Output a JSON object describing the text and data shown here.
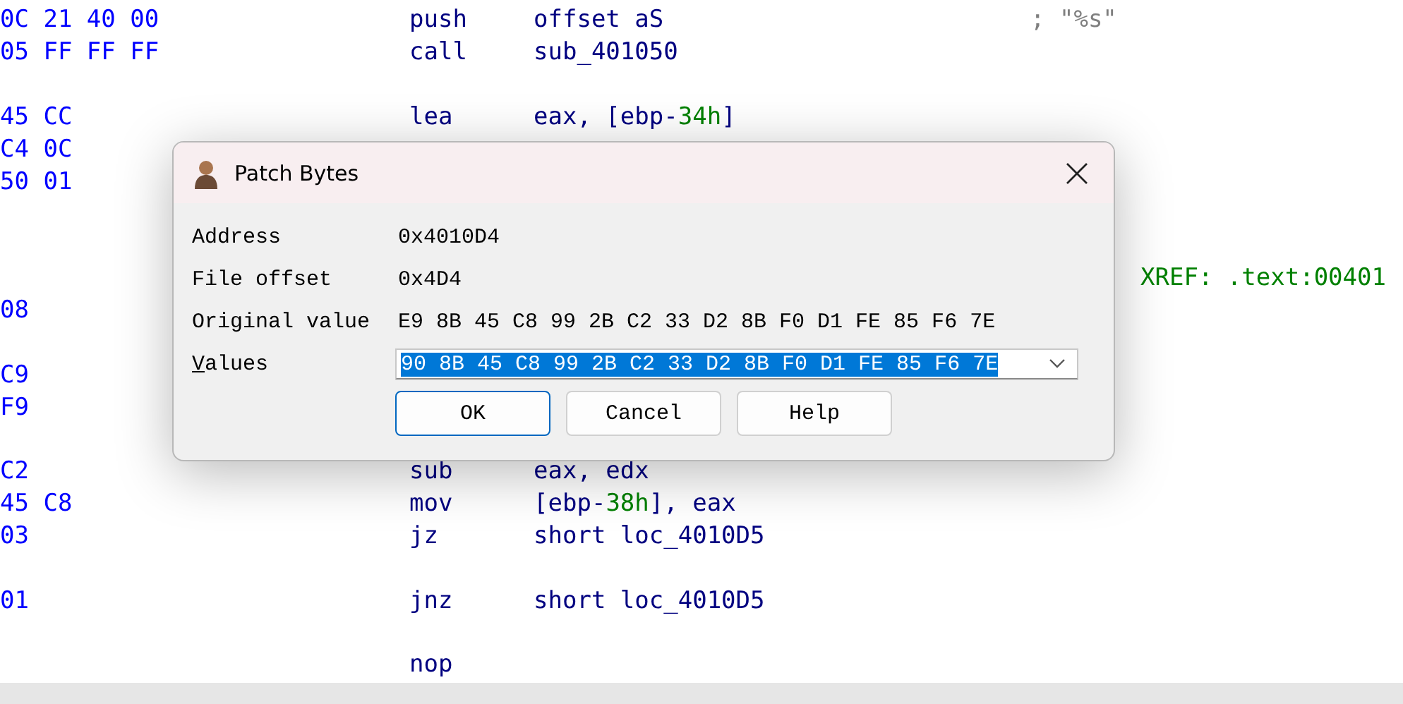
{
  "listing": [
    {
      "kind": "code",
      "bytes": "0C 21 40 00",
      "mnemonic": "push",
      "operand": [
        {
          "kind": "plain",
          "text": "offset aS"
        }
      ],
      "comment": "; \"%s\""
    },
    {
      "kind": "code",
      "bytes": "05 FF FF FF",
      "mnemonic": "call",
      "operand": [
        {
          "kind": "plain",
          "text": "sub_401050"
        }
      ]
    },
    {
      "kind": "blank"
    },
    {
      "kind": "code",
      "bytes": "45 CC",
      "mnemonic": "lea",
      "operand": [
        {
          "kind": "plain",
          "text": "eax, [ebp-"
        },
        {
          "kind": "number",
          "text": "34h"
        },
        {
          "kind": "plain",
          "text": "]"
        }
      ]
    },
    {
      "kind": "code",
      "bytes": "C4 0C"
    },
    {
      "kind": "code",
      "bytes": "50 01"
    },
    {
      "kind": "blank"
    },
    {
      "kind": "blank"
    },
    {
      "kind": "xref",
      "text": "XREF: .text:00401"
    },
    {
      "kind": "code",
      "bytes": "08"
    },
    {
      "kind": "blank"
    },
    {
      "kind": "code",
      "bytes": "C9"
    },
    {
      "kind": "code",
      "bytes": "F9"
    },
    {
      "kind": "blank"
    },
    {
      "kind": "code",
      "bytes": "C2",
      "mnemonic": "sub",
      "operand": [
        {
          "kind": "plain",
          "text": "eax, edx"
        }
      ]
    },
    {
      "kind": "code",
      "bytes": "45 C8",
      "mnemonic": "mov",
      "operand": [
        {
          "kind": "plain",
          "text": "[ebp-"
        },
        {
          "kind": "number",
          "text": "38h"
        },
        {
          "kind": "plain",
          "text": "], eax"
        }
      ]
    },
    {
      "kind": "code",
      "bytes": "03",
      "mnemonic": "jz",
      "operand": [
        {
          "kind": "plain",
          "text": "short loc_4010D5"
        }
      ]
    },
    {
      "kind": "blank"
    },
    {
      "kind": "code",
      "bytes": "01",
      "mnemonic": "jnz",
      "operand": [
        {
          "kind": "plain",
          "text": "short loc_4010D5"
        }
      ]
    },
    {
      "kind": "blank"
    },
    {
      "kind": "code",
      "mnemonic": "nop"
    }
  ],
  "dialog": {
    "title": "Patch Bytes",
    "fields": [
      {
        "label": "Address",
        "value": "0x4010D4"
      },
      {
        "label": "File offset",
        "value": "0x4D4"
      },
      {
        "label": "Original value",
        "value": "E9 8B 45 C8 99 2B C2 33 D2 8B F0 D1 FE 85 F6 7E"
      }
    ],
    "values": {
      "label": "Values",
      "value": "90 8B 45 C8 99 2B C2 33 D2 8B F0 D1 FE 85 F6 7E"
    },
    "buttons": [
      {
        "label": "OK",
        "selected": true
      },
      {
        "label": "Cancel",
        "selected": false
      },
      {
        "label": "Help",
        "selected": false
      }
    ]
  }
}
